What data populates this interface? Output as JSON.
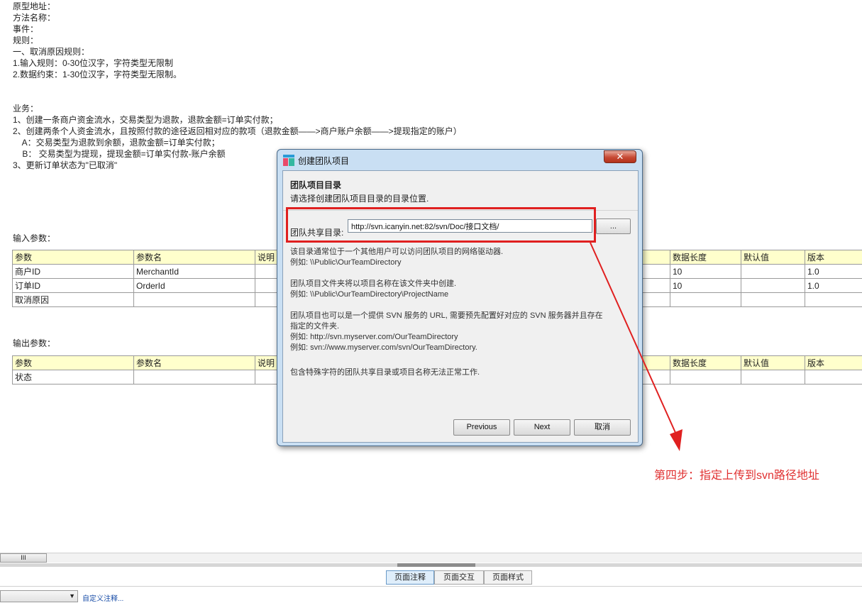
{
  "doc": {
    "lines": [
      "原型地址：",
      "方法名称：",
      "事件：",
      "规则：",
      "一、取消原因规则：",
      "1.输入规则：0-30位汉字，字符类型无限制",
      "2.数据约束：1-30位汉字，字符类型无限制。"
    ],
    "business_lines": [
      "业务：",
      "1、创建一条商户资金流水，交易类型为退款，退款金额=订单实付款；",
      "2、创建两条个人资金流水，且按照付款的途径返回相对应的款项（退款金额——>商户账户余额——>提现指定的账户）",
      "    A：交易类型为退款到余额，退款金额=订单实付款；",
      "    B： 交易类型为提现，提现金额=订单实付款-账户余额",
      "3、更新订单状态为\"已取消\""
    ],
    "input_label": "输入参数：",
    "output_label": "输出参数："
  },
  "input_table": {
    "headers": [
      "参数",
      "参数名",
      "说明",
      "",
      "",
      "",
      "数据长度",
      "默认值",
      "版本"
    ],
    "rows": [
      [
        "商户ID",
        "MerchantId",
        "",
        "",
        "",
        "",
        "10",
        "",
        "1.0"
      ],
      [
        "订单ID",
        "OrderId",
        "",
        "",
        "",
        "",
        "10",
        "",
        "1.0"
      ],
      [
        "取消原因",
        "",
        "",
        "",
        "",
        "",
        "",
        "",
        ""
      ]
    ]
  },
  "output_table": {
    "headers": [
      "参数",
      "参数名",
      "说明",
      "",
      "",
      "",
      "数据长度",
      "默认值",
      "版本"
    ],
    "rows": [
      [
        "状态",
        "",
        "",
        "",
        "",
        "",
        "",
        "",
        ""
      ]
    ]
  },
  "dialog": {
    "title": "创建团队项目",
    "close_label": "✕",
    "heading": "团队项目目录",
    "subheading": "请选择创建团队项目目录的目录位置.",
    "field_label": "团队共享目录:",
    "field_value": "http://svn.icanyin.net:82/svn/Doc/接口文档/",
    "browse_label": "...",
    "desc": [
      "该目录通常位于一个其他用户可以访问团队项目的网络驱动器.",
      "例如: \\\\Public\\OurTeamDirectory",
      "团队项目文件夹将以项目名称在该文件夹中创建.",
      "例如: \\\\Public\\OurTeamDirectory\\ProjectName",
      "团队项目也可以是一个提供 SVN 服务的 URL, 需要预先配置好对应的 SVN 服务器并且存在",
      "指定的文件夹.",
      "例如: http://svn.myserver.com/OurTeamDirectory",
      "例如: svn://www.myserver.com/svn/OurTeamDirectory.",
      "包含特殊字符的团队共享目录或项目名称无法正常工作."
    ],
    "buttons": {
      "previous": "Previous",
      "next": "Next",
      "cancel": "取消"
    }
  },
  "annotation": {
    "text": "第四步：指定上传到svn路径地址",
    "color": "#e03030"
  },
  "bottom": {
    "scroll_thumb": "III",
    "tabs": [
      "页面注释",
      "页面交互",
      "页面样式"
    ],
    "custom_link": "自定义注释..."
  }
}
